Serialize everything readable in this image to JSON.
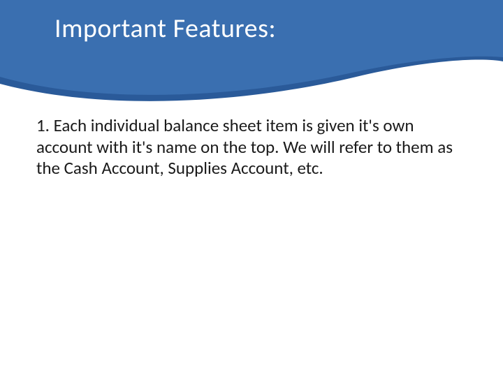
{
  "header": {
    "title": "Important Features:"
  },
  "body": {
    "paragraph": "1. Each individual balance sheet item is given it's own account with it's name on the top. We will refer to them as the Cash Account, Supplies Account, etc."
  },
  "colors": {
    "band": "#3a6fb0",
    "swoop_dark": "#2a5a99",
    "text": "#1a1a1a"
  }
}
